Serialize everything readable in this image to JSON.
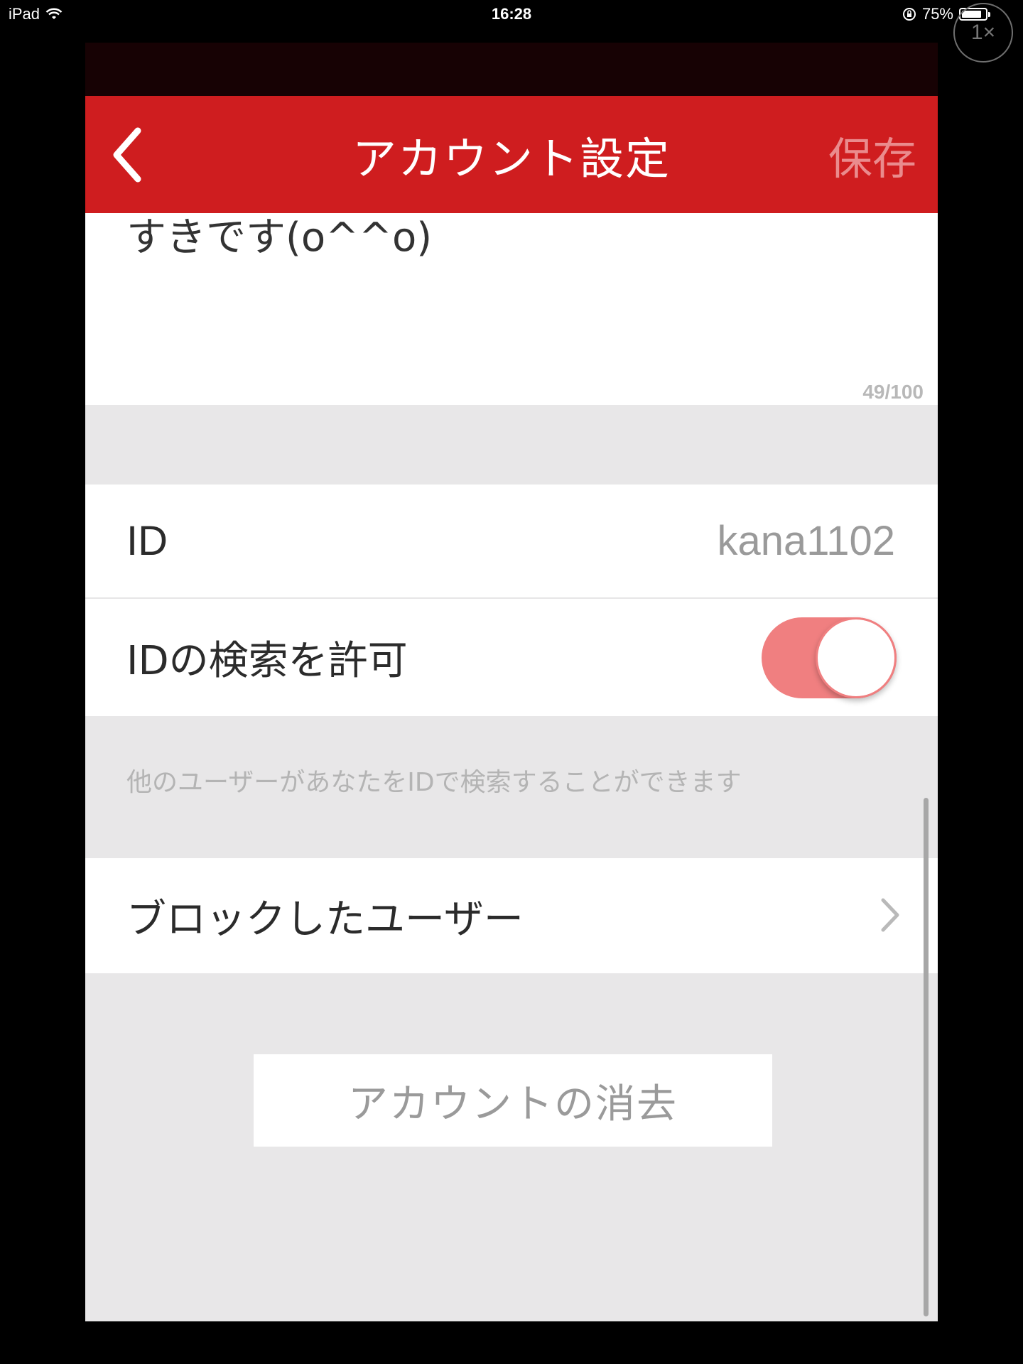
{
  "status_bar": {
    "device": "iPad",
    "time": "16:28",
    "battery": "75%",
    "battery_level": 0.75
  },
  "zoom_badge": {
    "label": "1×"
  },
  "nav": {
    "title": "アカウント設定",
    "save_label": "保存",
    "back_icon": "chevron-left-icon"
  },
  "profile": {
    "bio_text": "すきです(o^^o)",
    "bio_counter": "49/100"
  },
  "settings": {
    "id_label": "ID",
    "id_value": "kana1102",
    "search_label": "IDの検索を許可",
    "search_enabled": true,
    "search_hint": "他のユーザーがあなたをIDで検索することができます",
    "blocked_label": "ブロックしたユーザー"
  },
  "actions": {
    "delete_label": "アカウントの消去"
  },
  "colors": {
    "nav_background": "#cf1d1f",
    "toggle_on": "#f07f80",
    "page_background": "#e8e7e8"
  }
}
